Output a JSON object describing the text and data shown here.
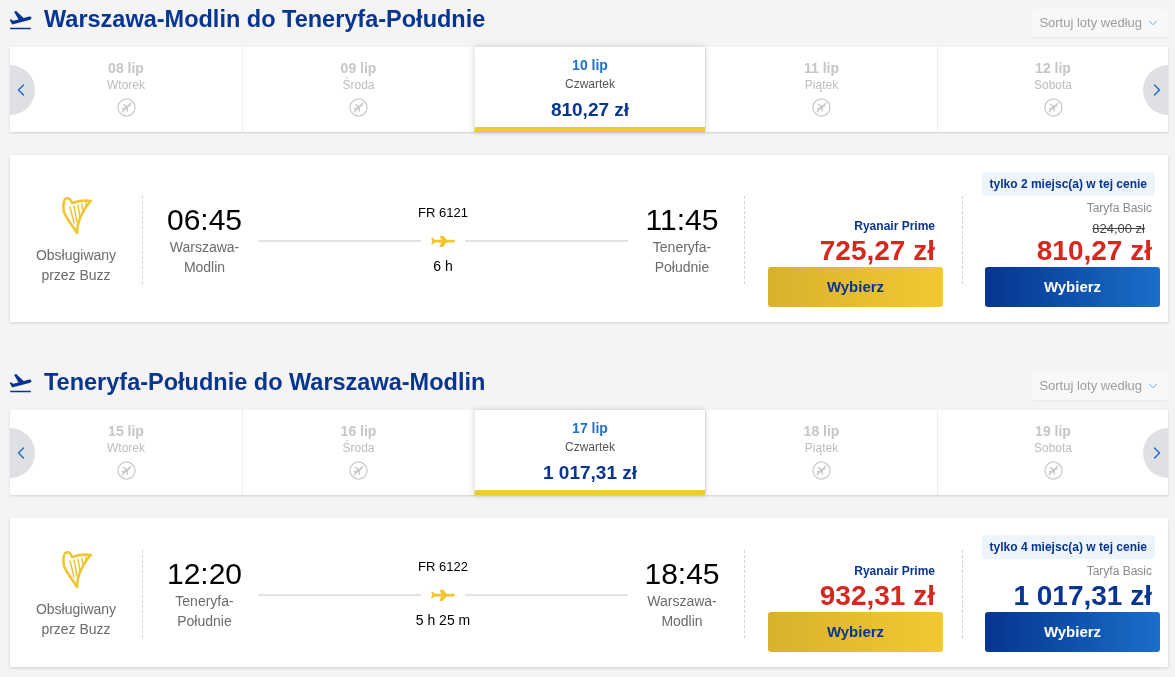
{
  "sections": [
    {
      "title": "Warszawa-Modlin do Teneryfa-Południe",
      "sort_label": "Sortuj loty według",
      "dates": [
        {
          "date": "08 lip",
          "day": "Wtorek",
          "available": false,
          "selected": false
        },
        {
          "date": "09 lip",
          "day": "Środa",
          "available": false,
          "selected": false
        },
        {
          "date": "10 lip",
          "day": "Czwartek",
          "available": true,
          "price": "810,27 zł",
          "selected": true
        },
        {
          "date": "11 lip",
          "day": "Piątek",
          "available": false,
          "selected": false
        },
        {
          "date": "12 lip",
          "day": "Sobota",
          "available": false,
          "selected": false
        }
      ],
      "flight": {
        "operator": "Obsługiwany przez Buzz",
        "departure": {
          "time": "06:45",
          "city": "Warszawa-Modlin"
        },
        "flight_number": "FR 6121",
        "duration": "6 h",
        "arrival": {
          "time": "11:45",
          "city": "Teneryfa-Południe"
        },
        "fares": [
          {
            "kind": "prime",
            "label": "Ryanair Prime",
            "price": "725,27 zł",
            "discounted": true,
            "button": "Wybierz"
          },
          {
            "kind": "basic",
            "badge": "tylko 2 miejsc(a) w tej cenie",
            "label": "Taryfa Basic",
            "old_price": "824,00 zł",
            "price": "810,27 zł",
            "discounted": true,
            "button": "Wybierz"
          }
        ]
      }
    },
    {
      "title": "Teneryfa-Południe do Warszawa-Modlin",
      "sort_label": "Sortuj loty według",
      "dates": [
        {
          "date": "15 lip",
          "day": "Wtorek",
          "available": false,
          "selected": false
        },
        {
          "date": "16 lip",
          "day": "Środa",
          "available": false,
          "selected": false
        },
        {
          "date": "17 lip",
          "day": "Czwartek",
          "available": true,
          "price": "1 017,31 zł",
          "selected": true
        },
        {
          "date": "18 lip",
          "day": "Piątek",
          "available": false,
          "selected": false
        },
        {
          "date": "19 lip",
          "day": "Sobota",
          "available": false,
          "selected": false
        }
      ],
      "flight": {
        "operator": "Obsługiwany przez Buzz",
        "departure": {
          "time": "12:20",
          "city": "Teneryfa-Południe"
        },
        "flight_number": "FR 6122",
        "duration": "5 h 25 m",
        "arrival": {
          "time": "18:45",
          "city": "Warszawa-Modlin"
        },
        "fares": [
          {
            "kind": "prime",
            "label": "Ryanair Prime",
            "price": "932,31 zł",
            "discounted": true,
            "button": "Wybierz"
          },
          {
            "kind": "basic",
            "badge": "tylko 4 miejsc(a) w tej cenie",
            "label": "Taryfa Basic",
            "price": "1 017,31 zł",
            "discounted": false,
            "button": "Wybierz"
          }
        ]
      }
    }
  ]
}
